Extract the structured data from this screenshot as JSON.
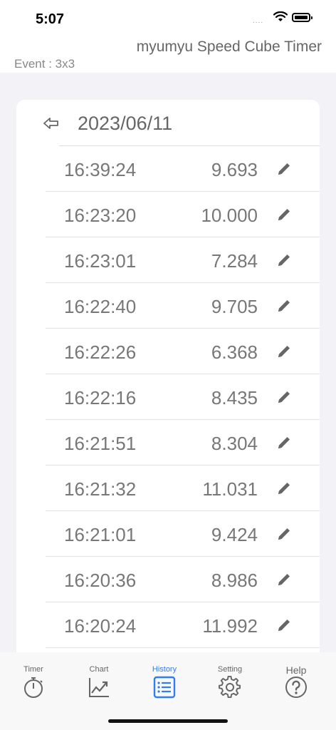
{
  "status_bar": {
    "time": "5:07",
    "dots": "....",
    "wifi_icon": "wifi-icon",
    "battery_icon": "battery-icon"
  },
  "header": {
    "app_title": "myumyu Speed Cube Timer",
    "event": "Event : 3x3"
  },
  "history": {
    "date": "2023/06/11",
    "back_icon": "back-arrow-icon",
    "records": [
      {
        "time": "16:39:24",
        "value": "9.693"
      },
      {
        "time": "16:23:20",
        "value": "10.000"
      },
      {
        "time": "16:23:01",
        "value": "7.284"
      },
      {
        "time": "16:22:40",
        "value": "9.705"
      },
      {
        "time": "16:22:26",
        "value": "6.368"
      },
      {
        "time": "16:22:16",
        "value": "8.435"
      },
      {
        "time": "16:21:51",
        "value": "8.304"
      },
      {
        "time": "16:21:32",
        "value": "11.031"
      },
      {
        "time": "16:21:01",
        "value": "9.424"
      },
      {
        "time": "16:20:36",
        "value": "8.986"
      },
      {
        "time": "16:20:24",
        "value": "11.992"
      }
    ]
  },
  "tabs": [
    {
      "label": "Timer",
      "icon": "stopwatch-icon",
      "active": false
    },
    {
      "label": "Chart",
      "icon": "chart-icon",
      "active": false
    },
    {
      "label": "History",
      "icon": "list-icon",
      "active": true
    },
    {
      "label": "Setting",
      "icon": "gear-icon",
      "active": false
    },
    {
      "label": "Help",
      "icon": "help-icon",
      "active": false
    }
  ],
  "colors": {
    "accent": "#2f7ef5",
    "text_gray": "#777777",
    "background": "#f2f2f7"
  }
}
